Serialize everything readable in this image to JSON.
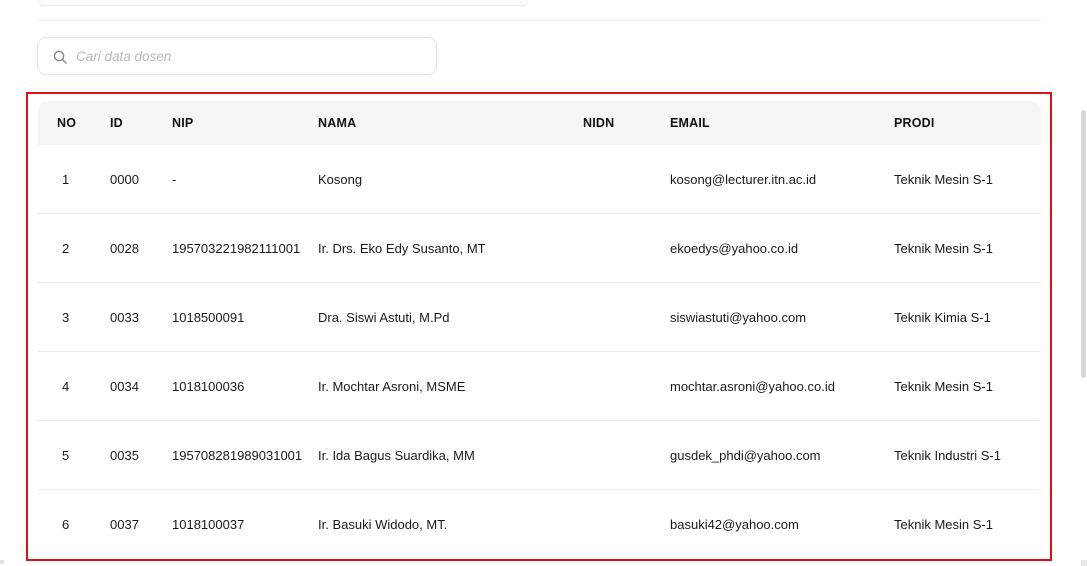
{
  "search": {
    "placeholder": "Cari data dosen",
    "value": ""
  },
  "table": {
    "columns": {
      "no": "NO",
      "id": "ID",
      "nip": "NIP",
      "nama": "NAMA",
      "nidn": "NIDN",
      "email": "EMAIL",
      "prodi": "PRODI"
    },
    "rows": [
      {
        "no": "1",
        "id": "0000",
        "nip": "-",
        "nama": "Kosong",
        "nidn": "",
        "email": "kosong@lecturer.itn.ac.id",
        "prodi": "Teknik Mesin S-1"
      },
      {
        "no": "2",
        "id": "0028",
        "nip": "195703221982111001",
        "nama": "Ir. Drs. Eko Edy Susanto, MT",
        "nidn": "",
        "email": "ekoedys@yahoo.co.id",
        "prodi": "Teknik Mesin S-1"
      },
      {
        "no": "3",
        "id": "0033",
        "nip": "1018500091",
        "nama": "Dra. Siswi Astuti, M.Pd",
        "nidn": "",
        "email": "siswiastuti@yahoo.com",
        "prodi": "Teknik Kimia S-1"
      },
      {
        "no": "4",
        "id": "0034",
        "nip": "1018100036",
        "nama": "Ir. Mochtar Asroni, MSME",
        "nidn": "",
        "email": "mochtar.asroni@yahoo.co.id",
        "prodi": "Teknik Mesin S-1"
      },
      {
        "no": "5",
        "id": "0035",
        "nip": "195708281989031001",
        "nama": "Ir. Ida Bagus Suardika, MM",
        "nidn": "",
        "email": "gusdek_phdi@yahoo.com",
        "prodi": "Teknik Industri S-1"
      },
      {
        "no": "6",
        "id": "0037",
        "nip": "1018100037",
        "nama": "Ir. Basuki Widodo, MT.",
        "nidn": "",
        "email": "basuki42@yahoo.com",
        "prodi": "Teknik Mesin S-1"
      }
    ]
  },
  "icons": {
    "search": "search-icon"
  },
  "colors": {
    "highlight": "#e01010",
    "header_bg": "#f5f5f5",
    "placeholder": "#b8b8b8"
  }
}
